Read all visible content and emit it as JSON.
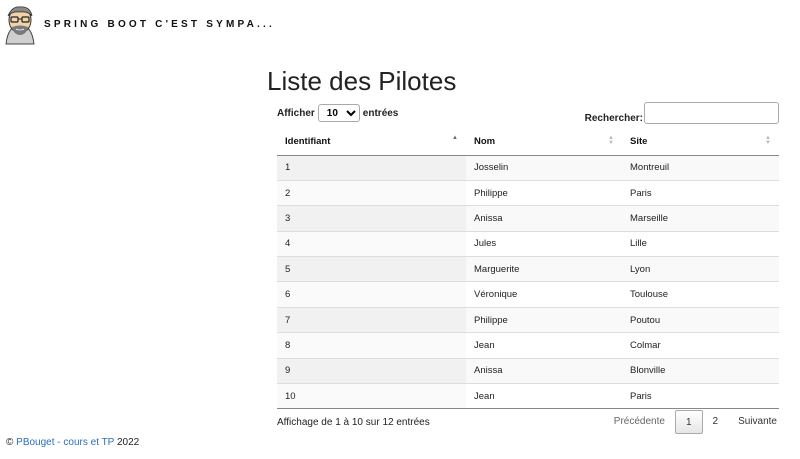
{
  "header": {
    "site_title": "SPRING BOOT C'EST SYMPA...",
    "avatar_icon": "cartoon-avatar-icon"
  },
  "main": {
    "title": "Liste des Pilotes",
    "length": {
      "label_before": "Afficher",
      "selected": "10",
      "label_after": "entrées"
    },
    "search": {
      "label": "Rechercher:",
      "value": ""
    },
    "table": {
      "columns": [
        "Identifiant",
        "Nom",
        "Site"
      ],
      "rows": [
        [
          "1",
          "Josselin",
          "Montreuil"
        ],
        [
          "2",
          "Philippe",
          "Paris"
        ],
        [
          "3",
          "Anissa",
          "Marseille"
        ],
        [
          "4",
          "Jules",
          "Lille"
        ],
        [
          "5",
          "Marguerite",
          "Lyon"
        ],
        [
          "6",
          "Véronique",
          "Toulouse"
        ],
        [
          "7",
          "Philippe",
          "Poutou"
        ],
        [
          "8",
          "Jean",
          "Colmar"
        ],
        [
          "9",
          "Anissa",
          "Blonville"
        ],
        [
          "10",
          "Jean",
          "Paris"
        ]
      ]
    },
    "info": "Affichage de 1 à 10 sur 12 entrées",
    "pagination": {
      "previous": "Précédente",
      "pages": [
        "1",
        "2"
      ],
      "current": "1",
      "next": "Suivante"
    }
  },
  "footer": {
    "copyright": "©",
    "link_text": "PBouget - cours et TP",
    "year": "2022"
  }
}
